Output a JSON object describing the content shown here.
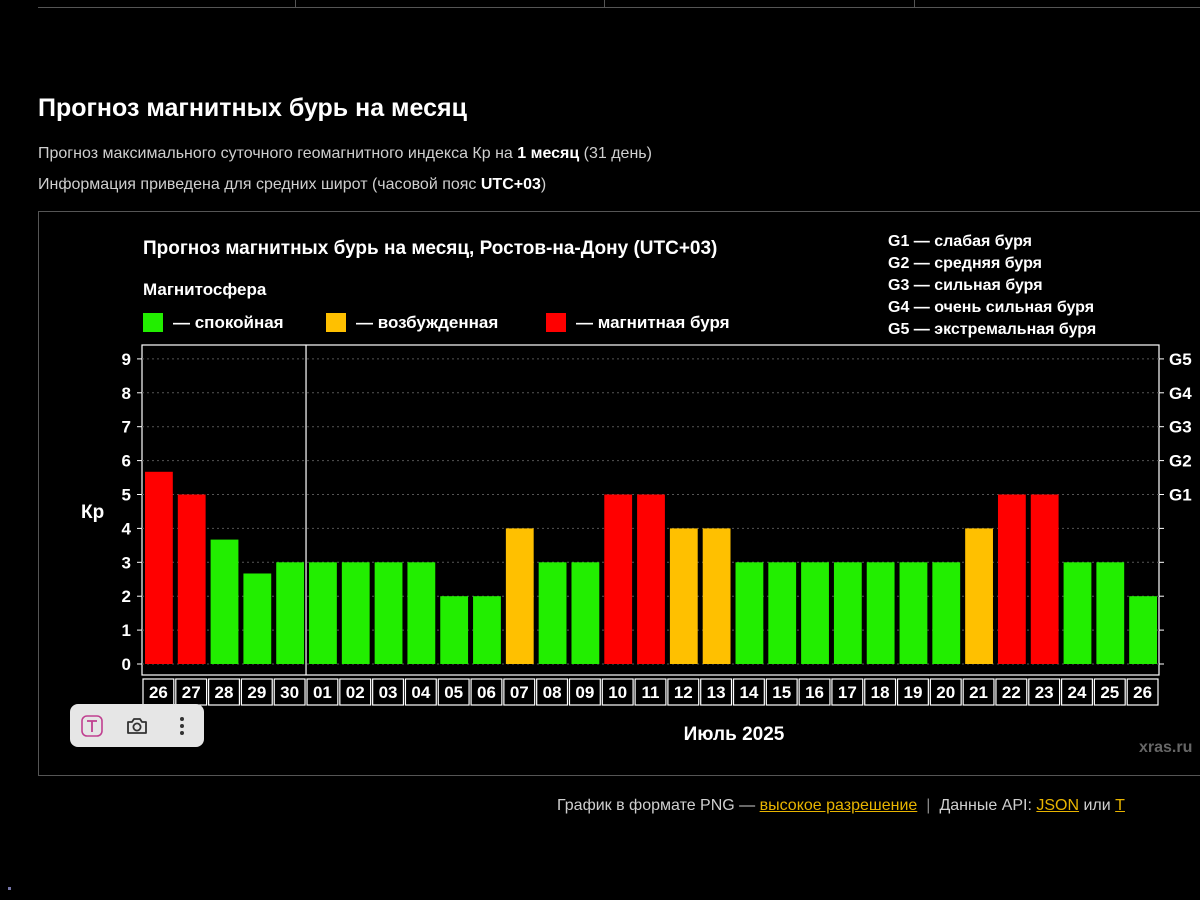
{
  "page": {
    "title": "Прогноз магнитных бурь на месяц",
    "desc1": {
      "prefix": "Прогноз максимального суточного геомагнитного индекса Кр на ",
      "bold": "1 месяц",
      "suffix": " (31 день)"
    },
    "desc2": {
      "prefix": "Информация приведена для средних широт (часовой пояс ",
      "bold": "UTC+03",
      "suffix": ")"
    }
  },
  "toolbar": {
    "text_icon": "text-select-icon",
    "camera_icon": "camera-icon",
    "more_icon": "more-vertical-icon"
  },
  "footer": {
    "png_text": "График в формате PNG — ",
    "png_link": "высокое разрешение",
    "separator": "|",
    "api_text": "Данные API: ",
    "json_link": "JSON",
    "or_text": " или ",
    "tail_link": "T"
  },
  "chart_data": {
    "type": "bar",
    "title": "Прогноз магнитных бурь на месяц, Ростов-на-Дону (UTC+03)",
    "legend_title": "Магнитосфера",
    "legend": [
      {
        "label": "— спокойная",
        "color": "#22ee00"
      },
      {
        "label": "— возбужденная",
        "color": "#ffc000"
      },
      {
        "label": "— магнитная буря",
        "color": "#ff0000"
      }
    ],
    "g_scale": [
      "G1 — слабая буря",
      "G2 — средняя буря",
      "G3 — сильная буря",
      "G4 — очень сильная буря",
      "G5 — экстремальная буря"
    ],
    "ylabel": "Кр",
    "xlabel": "Июль 2025",
    "watermark": "xras.ru",
    "ylim": [
      0,
      9
    ],
    "yticks": [
      "0",
      "1",
      "2",
      "3",
      "4",
      "5",
      "6",
      "7",
      "8",
      "9"
    ],
    "right_ticks": [
      {
        "label": "G1",
        "value": 5
      },
      {
        "label": "G2",
        "value": 6
      },
      {
        "label": "G3",
        "value": 7
      },
      {
        "label": "G4",
        "value": 8
      },
      {
        "label": "G5",
        "value": 9
      }
    ],
    "categories": [
      "26",
      "27",
      "28",
      "29",
      "30",
      "01",
      "02",
      "03",
      "04",
      "05",
      "06",
      "07",
      "08",
      "09",
      "10",
      "11",
      "12",
      "13",
      "14",
      "15",
      "16",
      "17",
      "18",
      "19",
      "20",
      "21",
      "22",
      "23",
      "24",
      "25",
      "26"
    ],
    "values": [
      5.67,
      5,
      3.67,
      2.67,
      3,
      3,
      3,
      3,
      3,
      2,
      2,
      4,
      3,
      3,
      5,
      5,
      4,
      4,
      3,
      3,
      3,
      3,
      3,
      3,
      3,
      4,
      5,
      5,
      3,
      3,
      2
    ],
    "bar_colors": [
      "#ff0000",
      "#ff0000",
      "#22ee00",
      "#22ee00",
      "#22ee00",
      "#22ee00",
      "#22ee00",
      "#22ee00",
      "#22ee00",
      "#22ee00",
      "#22ee00",
      "#ffc000",
      "#22ee00",
      "#22ee00",
      "#ff0000",
      "#ff0000",
      "#ffc000",
      "#ffc000",
      "#22ee00",
      "#22ee00",
      "#22ee00",
      "#22ee00",
      "#22ee00",
      "#22ee00",
      "#22ee00",
      "#ffc000",
      "#ff0000",
      "#ff0000",
      "#22ee00",
      "#22ee00",
      "#22ee00"
    ],
    "today_divider_after": "30",
    "grid": "dashed-major"
  }
}
